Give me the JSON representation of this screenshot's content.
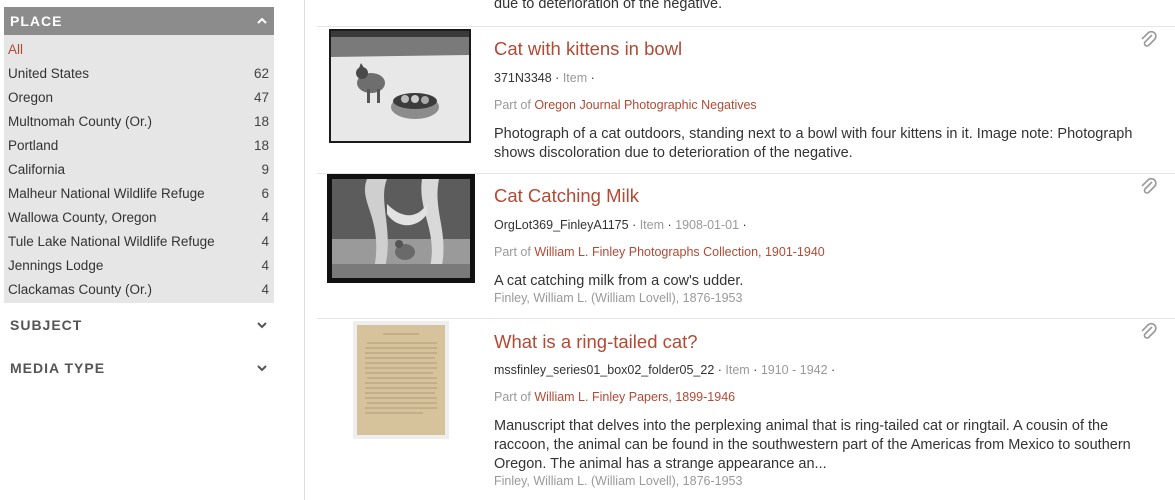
{
  "sidebar": {
    "place": {
      "title": "PLACE",
      "items": [
        {
          "label": "All",
          "count": ""
        },
        {
          "label": "United States",
          "count": "62"
        },
        {
          "label": "Oregon",
          "count": "47"
        },
        {
          "label": "Multnomah County (Or.)",
          "count": "18"
        },
        {
          "label": "Portland",
          "count": "18"
        },
        {
          "label": "California",
          "count": "9"
        },
        {
          "label": "Malheur National Wildlife Refuge",
          "count": "6"
        },
        {
          "label": "Wallowa County, Oregon",
          "count": "4"
        },
        {
          "label": "Tule Lake National Wildlife Refuge",
          "count": "4"
        },
        {
          "label": "Jennings Lodge",
          "count": "4"
        },
        {
          "label": "Clackamas County (Or.)",
          "count": "4"
        }
      ]
    },
    "subject": {
      "title": "SUBJECT"
    },
    "media_type": {
      "title": "MEDIA TYPE"
    }
  },
  "results": {
    "previous_tail": "due to deterioration of the negative.",
    "items": [
      {
        "title": "Cat with kittens in bowl",
        "identifier": "371N3348",
        "level": "Item",
        "dates": "",
        "part_of_prefix": "Part of",
        "part_of": "Oregon Journal Photographic Negatives",
        "description": "Photograph of a cat outdoors, standing next to a bowl with four kittens in it. Image note: Photograph shows discoloration due to deterioration of the negative.",
        "creator": ""
      },
      {
        "title": "Cat Catching Milk",
        "identifier": "OrgLot369_FinleyA1175",
        "level": "Item",
        "dates": "1908-01-01",
        "part_of_prefix": "Part of",
        "part_of": "William L. Finley Photographs Collection, 1901-1940",
        "description": "A cat catching milk from a cow's udder.",
        "creator": "Finley, William L. (William Lovell), 1876-1953"
      },
      {
        "title": "What is a ring-tailed cat?",
        "identifier": "mssfinley_series01_box02_folder05_22",
        "level": "Item",
        "dates": "1910 - 1942",
        "part_of_prefix": "Part of",
        "part_of": "William L. Finley Papers, 1899-1946",
        "description": "Manuscript that delves into the perplexing animal that is ring-tailed cat or ringtail. A cousin of the raccoon, the animal can be found in the southwestern part of the Americas from Mexico to southern Oregon. The animal has a strange appearance an...",
        "creator": "Finley, William L. (William Lovell), 1876-1953"
      }
    ]
  },
  "icons": {
    "chevron_up": "chevron-up-icon",
    "chevron_down": "chevron-down-icon",
    "attachment": "paperclip-icon"
  },
  "colors": {
    "link": "#b24a34",
    "facet_header": "#8c8c8c",
    "facet_bg": "#e6e6e6"
  }
}
